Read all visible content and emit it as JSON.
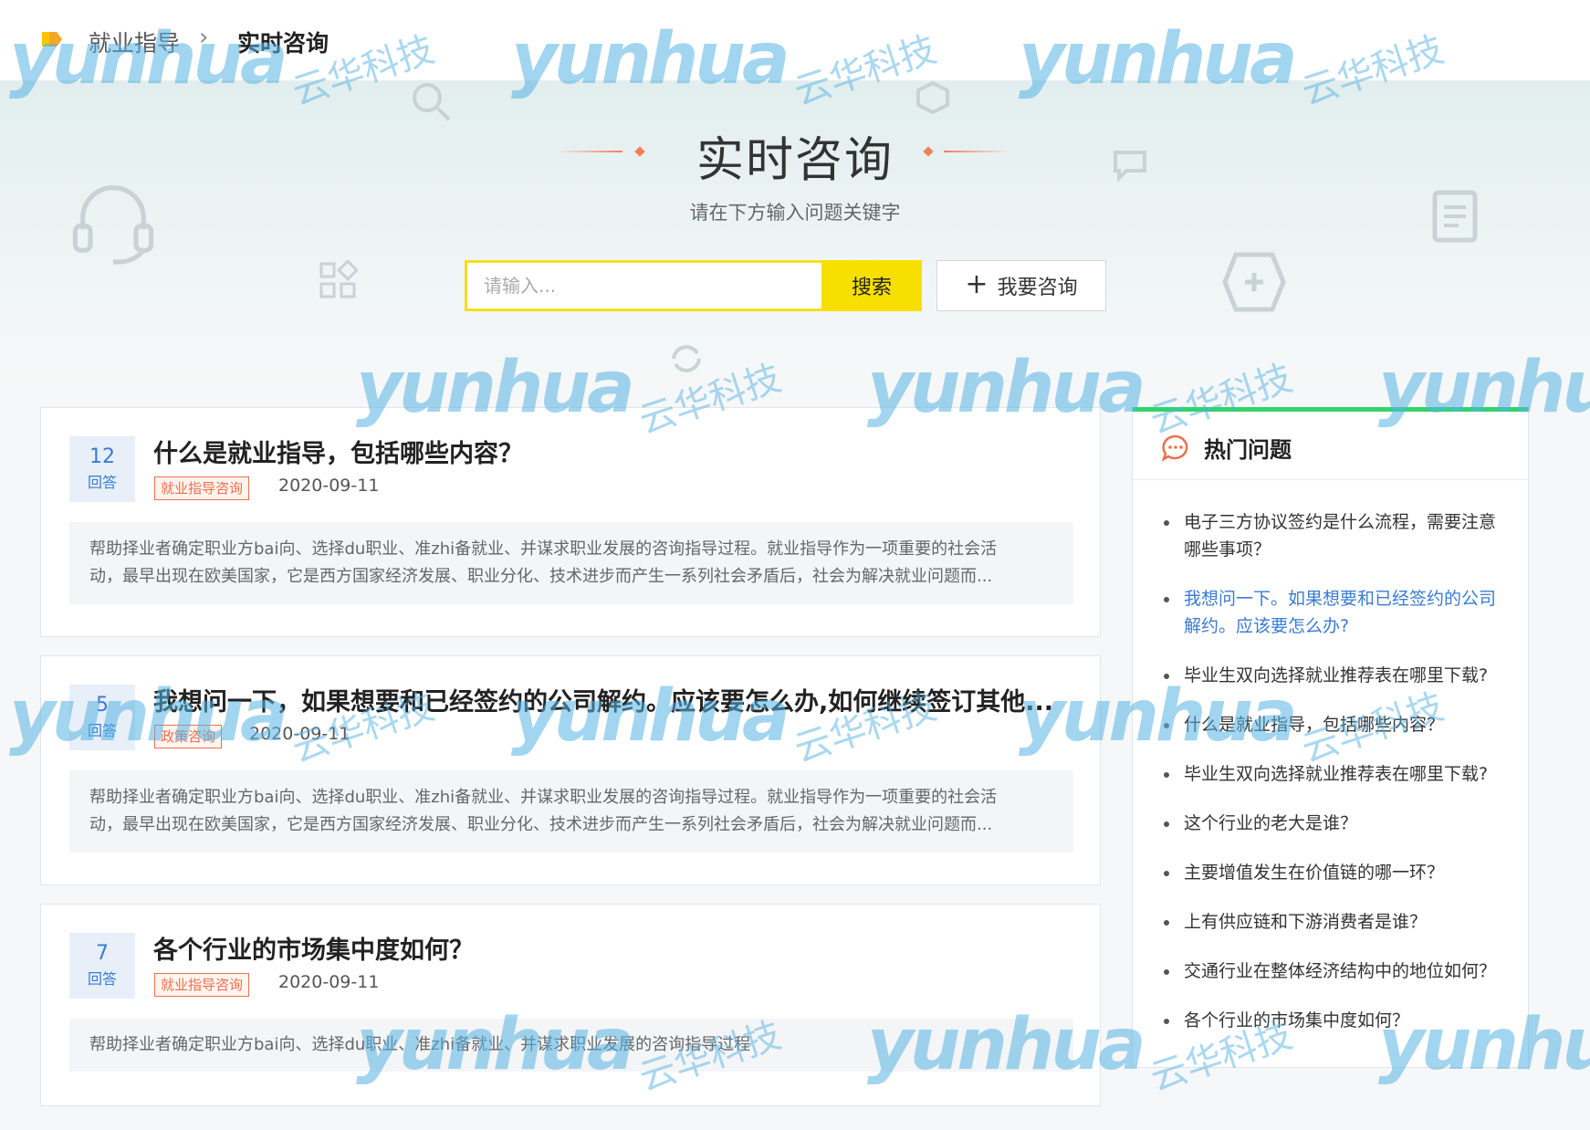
{
  "breadcrumb": {
    "home": "就业指导",
    "separator": "›",
    "current": "实时咨询"
  },
  "hero": {
    "title": "实时咨询",
    "subtitle": "请在下方输入问题关键字",
    "search_placeholder": "请输入...",
    "search_label": "搜索",
    "ask_label": "我要咨询"
  },
  "colors": {
    "accent_yellow": "#f7e000",
    "accent_green": "#2fd46a",
    "tag_red": "#ef6f4b",
    "link_blue": "#3a7bd5"
  },
  "questions": [
    {
      "count": "12",
      "count_label": "回答",
      "title": "什么是就业指导，包括哪些内容？",
      "tag": "就业指导咨询",
      "date": "2020-09-11",
      "excerpt_line1": "帮助择业者确定职业方bai向、选择du职业、准zhi备就业、并谋求职业发展的咨询指导过程。就业指导作为一项重要的社会活",
      "excerpt_line2": "动，最早出现在欧美国家，它是西方国家经济发展、职业分化、技术进步而产生一系列社会矛盾后，社会为解决就业问题而..."
    },
    {
      "count": "5",
      "count_label": "回答",
      "title": "我想问一下，如果想要和已经签约的公司解约。应该要怎么办,如何继续签订其他...",
      "tag": "政策咨询",
      "date": "2020-09-11",
      "excerpt_line1": "帮助择业者确定职业方bai向、选择du职业、准zhi备就业、并谋求职业发展的咨询指导过程。就业指导作为一项重要的社会活",
      "excerpt_line2": "动，最早出现在欧美国家，它是西方国家经济发展、职业分化、技术进步而产生一系列社会矛盾后，社会为解决就业问题而..."
    },
    {
      "count": "7",
      "count_label": "回答",
      "title": "各个行业的市场集中度如何？",
      "tag": "就业指导咨询",
      "date": "2020-09-11",
      "excerpt_line1": "帮助择业者确定职业方bai向、选择du职业、准zhi备就业、并谋求职业发展的咨询指导过程",
      "excerpt_line2": ""
    }
  ],
  "hot": {
    "title": "热门问题",
    "items": [
      "电子三方协议签约是什么流程，需要注意哪些事项？",
      "我想问一下。如果想要和已经签约的公司解约。应该要怎么办?",
      "毕业生双向选择就业推荐表在哪里下载?",
      "什么是就业指导，包括哪些内容？",
      "毕业生双向选择就业推荐表在哪里下载?",
      "这个行业的老大是谁？",
      "主要增值发生在价值链的哪一环？",
      "上有供应链和下游消费者是谁？",
      "交通行业在整体经济结构中的地位如何？",
      "各个行业的市场集中度如何？"
    ]
  },
  "watermark": {
    "logo": "yunhua",
    "cn": "云华科技"
  }
}
